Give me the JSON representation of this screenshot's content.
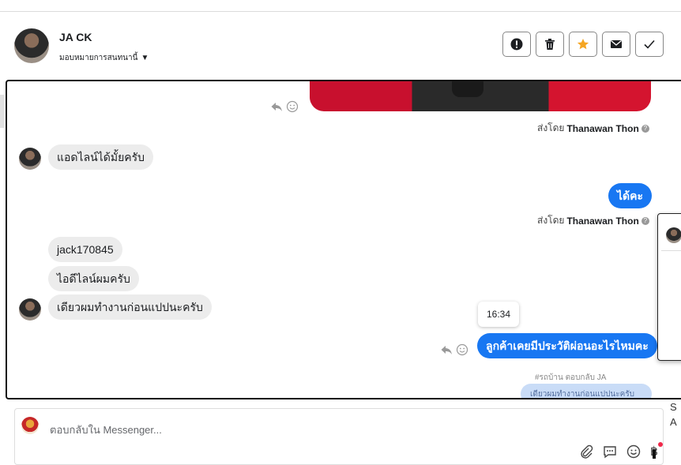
{
  "header": {
    "name": "JA CK",
    "assign_label": "มอบหมายการสนทนานี้",
    "actions": [
      "report-icon",
      "trash-icon",
      "star-icon",
      "mail-icon",
      "check-icon"
    ],
    "star_color": "#f5a623"
  },
  "messages": {
    "sent_by_1": {
      "prefix": "ส่งโดย",
      "name": "Thanawan Thon"
    },
    "in_1": "แอดไลน์ได้มั้ยครับ",
    "out_1": "ได้คะ",
    "sent_by_2": {
      "prefix": "ส่งโดย",
      "name": "Thanawan Thon"
    },
    "in_2": "jack170845",
    "in_3": "ไอดีไลน์ผมครับ",
    "in_4": "เดียวผมทำงานก่อนแปปนะครับ",
    "tooltip_time": "16:34",
    "out_2": "ลูกค้าเคยมีประวัติผ่อนอะไรไหมคะ",
    "reply_note": "#รถบ้าน ตอบกลับ JA",
    "reply_quote": "เดียวผมทำงานก่อนแปปนะครับ"
  },
  "side_fragments": {
    "line1": "S",
    "line2": "A"
  },
  "composer": {
    "placeholder": "ตอบกลับใน Messenger...",
    "tools": [
      "attach-icon",
      "saved-reply-icon",
      "emoji-icon",
      "baht-icon"
    ],
    "baht_glyph": "฿"
  },
  "colors": {
    "accent": "#1877f2",
    "incoming_bg": "#ececec"
  }
}
